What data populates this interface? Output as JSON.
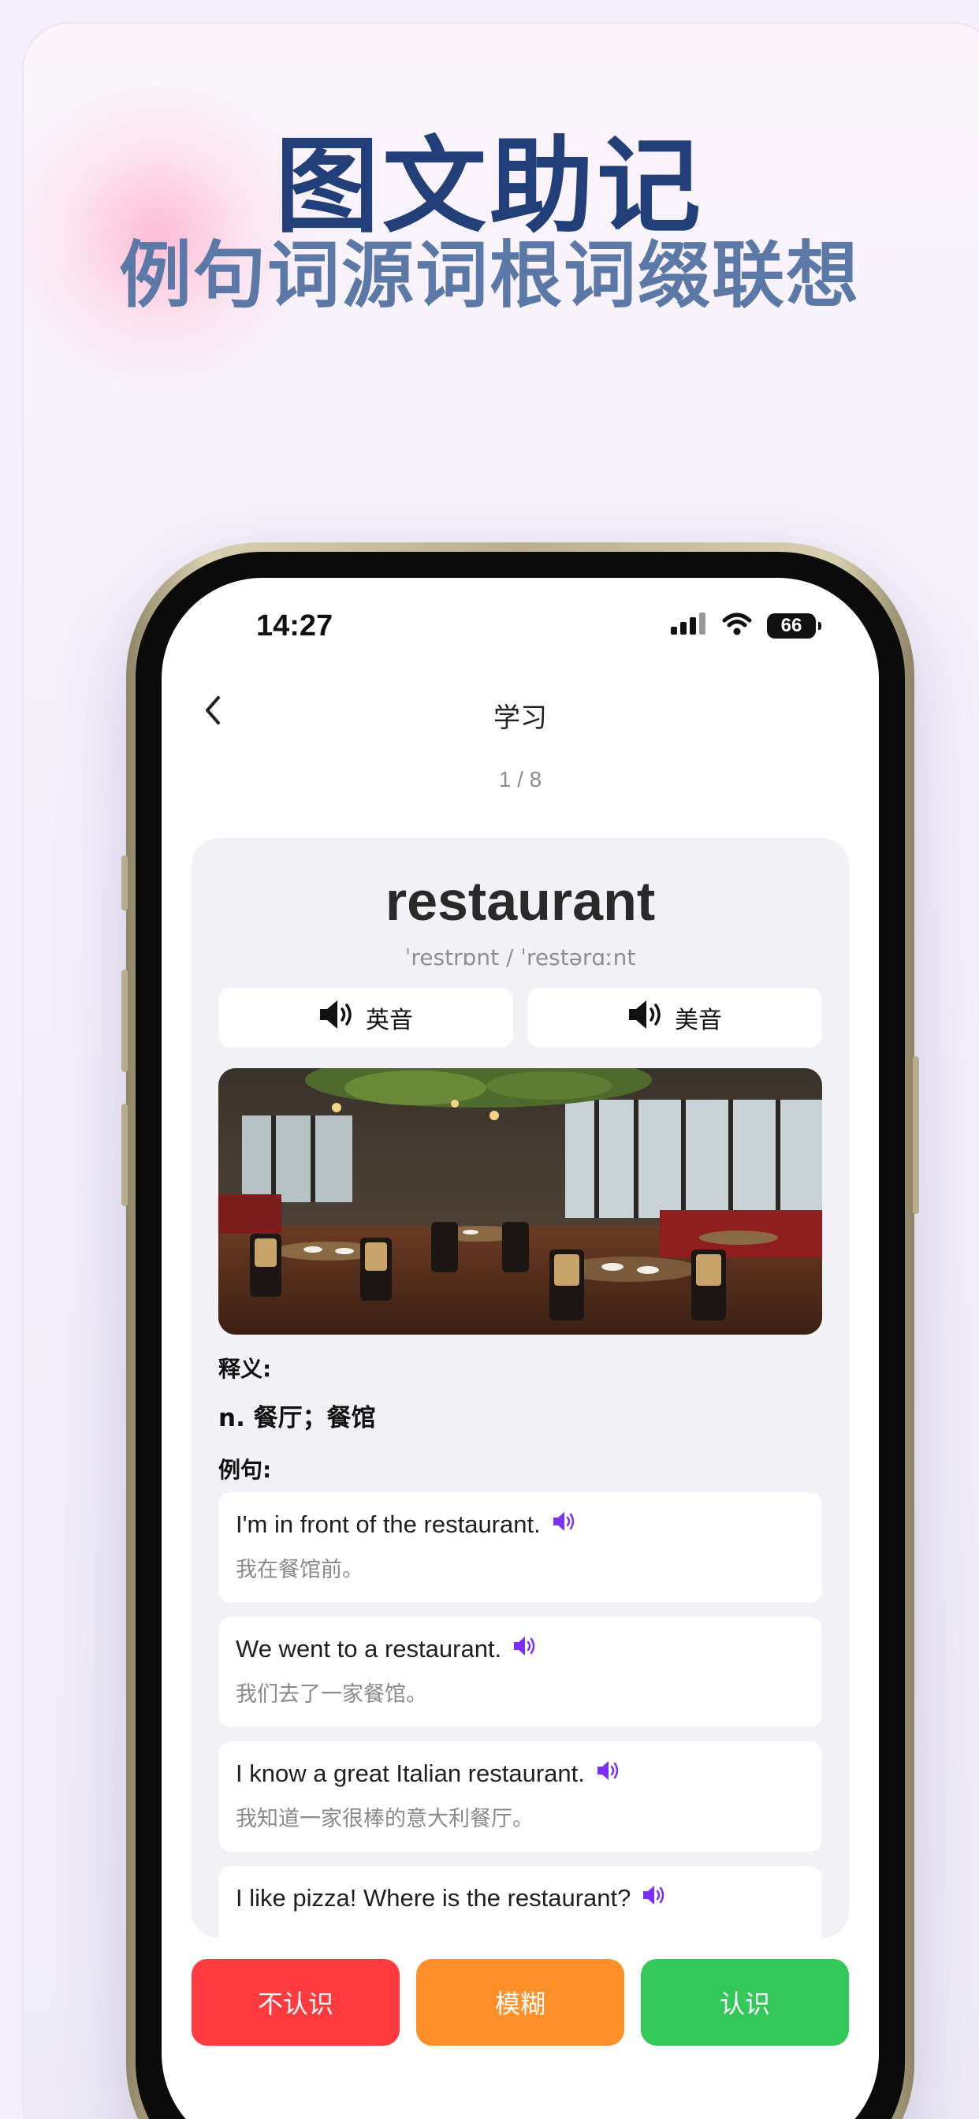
{
  "promo": {
    "headline": "图文助记",
    "subline": "例句词源词根词缀联想"
  },
  "status_bar": {
    "time": "14:27",
    "battery": "66",
    "icons": [
      "signal-icon",
      "wifi-icon",
      "battery-icon"
    ]
  },
  "nav": {
    "title": "学习",
    "progress": "1 / 8"
  },
  "word_card": {
    "word": "restaurant",
    "phonetic": "ˈrestrɒnt / ˈrestərɑːnt",
    "uk_label": "英音",
    "us_label": "美音",
    "meaning_label": "释义:",
    "meaning": "n. 餐厅；餐馆",
    "examples_label": "例句:",
    "examples": [
      {
        "en": "I'm in front of the restaurant.",
        "zh": "我在餐馆前。"
      },
      {
        "en": "We went to a restaurant.",
        "zh": "我们去了一家餐馆。"
      },
      {
        "en": "I know a great Italian restaurant.",
        "zh": "我知道一家很棒的意大利餐厅。"
      },
      {
        "en": "I like pizza! Where is the restaurant?",
        "zh": ""
      }
    ]
  },
  "actions": {
    "dont_know": "不认识",
    "vague": "模糊",
    "know": "认识"
  },
  "colors": {
    "accent_purple": "#7b2ff7",
    "dont_know": "#ff3b3f",
    "vague": "#ff902a",
    "know": "#34c759",
    "headline": "#233f7a",
    "subline": "#5b78a6"
  }
}
